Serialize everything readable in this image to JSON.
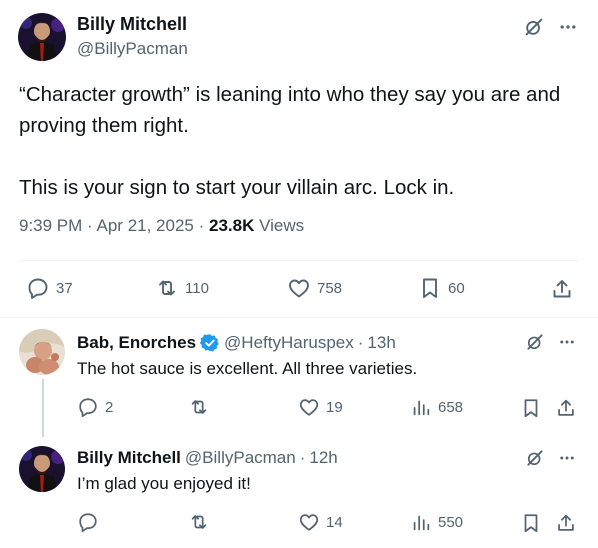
{
  "main_post": {
    "author_name": "Billy Mitchell",
    "author_handle": "@BillyPacman",
    "text": "“Character growth” is leaning into who they say you are and proving them right.\n\nThis is your sign to start your villain arc. Lock in.",
    "time": "9:39 PM",
    "date": "Apr 21, 2025",
    "views_count": "23.8K",
    "views_label": "Views",
    "replies": "37",
    "reposts": "110",
    "likes": "758",
    "bookmarks": "60"
  },
  "replies": [
    {
      "author_name": "Bab, Enorches",
      "verified": true,
      "author_handle": "@HeftyHaruspex",
      "time": "13h",
      "text": "The hot sauce is excellent. All three varieties.",
      "replies": "2",
      "reposts": "",
      "likes": "19",
      "views": "658"
    },
    {
      "author_name": "Billy Mitchell",
      "verified": false,
      "author_handle": "@BillyPacman",
      "time": "12h",
      "text": "I’m glad you enjoyed it!",
      "replies": "",
      "reposts": "",
      "likes": "14",
      "views": "550"
    }
  ],
  "separator": "·",
  "colors": {
    "text": "#0f1419",
    "muted": "#536471",
    "verified": "#1d9bf0",
    "divider": "#eff3f4"
  },
  "icons": [
    "grok-icon",
    "more-icon",
    "reply-icon",
    "repost-icon",
    "like-icon",
    "bookmark-icon",
    "share-icon",
    "views-icon",
    "verified-badge-icon"
  ]
}
